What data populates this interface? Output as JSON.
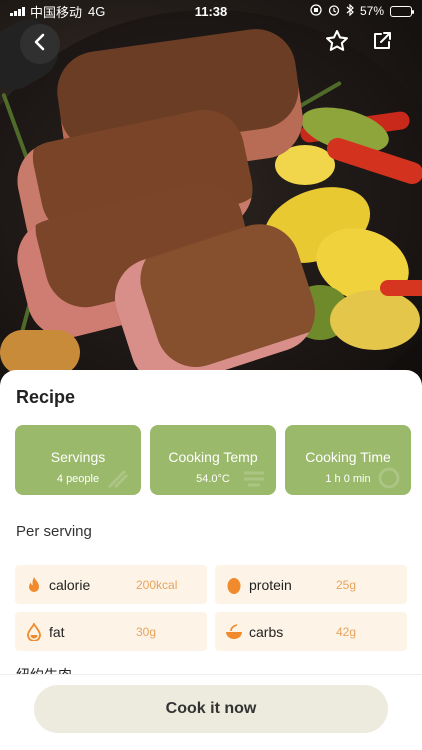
{
  "status_bar": {
    "carrier": "中国移动",
    "network": "4G",
    "time": "11:38",
    "battery": "57%",
    "battery_level": 0.57
  },
  "hero": {
    "image": "steak-with-vegetables-photo"
  },
  "header": {
    "back_icon": "chevron-left-icon",
    "favorite_icon": "star-outline-icon",
    "share_icon": "share-icon"
  },
  "recipe": {
    "title": "Recipe",
    "cards": [
      {
        "title": "Servings",
        "value": "4 people"
      },
      {
        "title": "Cooking Temp",
        "value": "54.0°C"
      },
      {
        "title": "Cooking Time",
        "value": "1 h 0 min"
      }
    ]
  },
  "nutrition": {
    "title": "Per serving",
    "items": [
      {
        "label": "calorie",
        "value": "200kcal",
        "icon": "flame-icon"
      },
      {
        "label": "protein",
        "value": "25g",
        "icon": "egg-icon"
      },
      {
        "label": "fat",
        "value": "30g",
        "icon": "oil-drop-icon"
      },
      {
        "label": "carbs",
        "value": "42g",
        "icon": "bowl-icon"
      }
    ]
  },
  "partial_text": "纽约牛肉",
  "cook_button": "Cook it now",
  "colors": {
    "card_green": "#9ab96a",
    "nutrition_bg": "#fdf4e7",
    "nutrition_value": "#e6a45e",
    "icon_orange": "#f08a2c",
    "button_bg": "#ecebdd"
  }
}
